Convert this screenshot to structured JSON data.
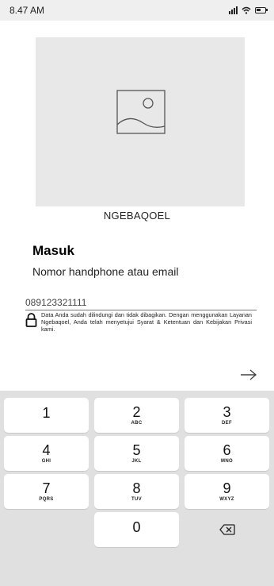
{
  "status_bar": {
    "time": "8.47 AM"
  },
  "app": {
    "name": "NGEBAQOEL"
  },
  "login": {
    "title": "Masuk",
    "field_label": "Nomor handphone atau email",
    "phone_value": "089123321111",
    "privacy_text": "Data Anda sudah dilindungi dan tidak dibagikan. Dengan menggunakan Layanan Ngebaqoel, Anda telah menyetujui Syarat & Ketentuan dan Kebijakan Privasi kami."
  },
  "icons": {
    "hero": "image-placeholder-icon",
    "lock": "lock-icon",
    "next": "arrow-right-icon",
    "backspace": "backspace-icon"
  },
  "keypad": {
    "keys": [
      {
        "digit": "1",
        "letters": ""
      },
      {
        "digit": "2",
        "letters": "ABC"
      },
      {
        "digit": "3",
        "letters": "DEF"
      },
      {
        "digit": "4",
        "letters": "GHI"
      },
      {
        "digit": "5",
        "letters": "JKL"
      },
      {
        "digit": "6",
        "letters": "MNO"
      },
      {
        "digit": "7",
        "letters": "PQRS"
      },
      {
        "digit": "8",
        "letters": "TUV"
      },
      {
        "digit": "9",
        "letters": "WXYZ"
      },
      {
        "digit": "0",
        "letters": ""
      }
    ]
  }
}
